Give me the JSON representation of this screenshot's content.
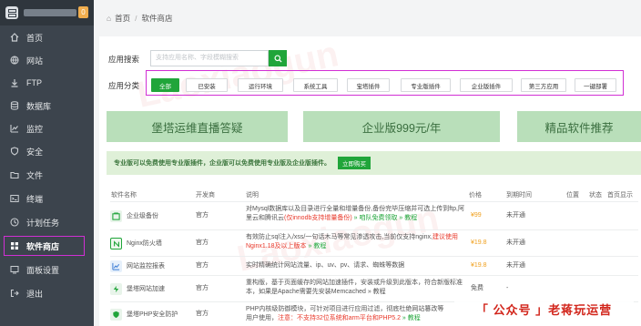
{
  "sidebar": {
    "badge": "0",
    "items": [
      {
        "label": "首页",
        "icon": "home-icon"
      },
      {
        "label": "网站",
        "icon": "globe-icon"
      },
      {
        "label": "FTP",
        "icon": "ftp-icon"
      },
      {
        "label": "数据库",
        "icon": "database-icon"
      },
      {
        "label": "监控",
        "icon": "monitor-icon"
      },
      {
        "label": "安全",
        "icon": "shield-icon"
      },
      {
        "label": "文件",
        "icon": "folder-icon"
      },
      {
        "label": "终端",
        "icon": "terminal-icon"
      },
      {
        "label": "计划任务",
        "icon": "clock-icon"
      },
      {
        "label": "软件商店",
        "icon": "store-icon"
      },
      {
        "label": "面板设置",
        "icon": "settings-icon"
      },
      {
        "label": "退出",
        "icon": "exit-icon"
      }
    ]
  },
  "breadcrumb": {
    "home": "首页",
    "current": "软件商店"
  },
  "search": {
    "label": "应用搜索",
    "placeholder": "支持应用名称、字段模糊搜索"
  },
  "categories": {
    "label": "应用分类",
    "items": [
      "全部",
      "已安装",
      "运行环境",
      "系统工具",
      "宝塔插件",
      "专业版插件",
      "企业版插件",
      "第三方应用",
      "一键部署"
    ],
    "active": "全部"
  },
  "banners": [
    "堡塔运维直播答疑",
    "企业版999元/年",
    "精品软件推荐"
  ],
  "notice": {
    "text": "专业版可以免费使用专业版插件，企业版可以免费使用专业版及企业版插件。",
    "button": "立即购买"
  },
  "table": {
    "headers": [
      "软件名称",
      "开发商",
      "说明",
      "价格",
      "到期时间",
      "位置",
      "状态",
      "首页显示"
    ],
    "rows": [
      {
        "name": "企业级备份",
        "icon": "backup-icon",
        "vendor": "官方",
        "desc1": "对Mysql数据库以及目录进行全量和增量备份,备份完毕压缩并可选上传到ftp,阿",
        "desc2": "里云和腾讯云",
        "desc2_red": "(仅innodb支持增量备份)",
        "desc2_tail": " » 咱队免费领取 » 教程",
        "price": "¥99",
        "expire": "未开通"
      },
      {
        "name": "Nginx防火墙",
        "icon": "firewall-icon",
        "vendor": "官方",
        "desc1": "有效防止sql注入/xss/一句话木马等常见渗透攻击,当前仅支持nginx,",
        "desc1_red": "建议使用",
        "desc2_red": "Nginx1.18及以上版本",
        "desc2_tail": " » 教程",
        "price": "¥19.8",
        "expire": "未开通"
      },
      {
        "name": "网站监控报表",
        "icon": "report-icon",
        "vendor": "官方",
        "desc1": "实时精确统计网站流量、ip、uv、pv、请求、蜘蛛等数据",
        "price": "¥19.8",
        "expire": "未开通"
      },
      {
        "name": "堡塔网站加速",
        "icon": "speed-icon",
        "vendor": "官方",
        "desc1": "重构版，基于页面缓存的网站加速插件，安装或升级到此版本，符合新版标准",
        "desc2": "本，如果是Apache需要先安装Memcached » 教程",
        "price": "免费",
        "expire": "-"
      },
      {
        "name": "堡塔PHP安全防护",
        "icon": "php-shield-icon",
        "vendor": "官方",
        "desc1": "PHP内核级防御模块，可针对项目进行应用过滤，彻底杜绝网站篡改等",
        "desc2_pre": "用户使用，",
        "desc2_red": "注意：不支持32位系统和arm平台和PHP5.2",
        "desc2_tail": " » 教程",
        "price": "",
        "expire": ""
      }
    ]
  },
  "watermark": "Laoxiaogun",
  "stamp": "「 公众号 」老蒋玩运营",
  "colors": {
    "accent": "#20a53a",
    "sidebar": "#3c444d",
    "highlight": "#d12fd4",
    "price": "#f0a01e",
    "warning": "#e8382a"
  }
}
